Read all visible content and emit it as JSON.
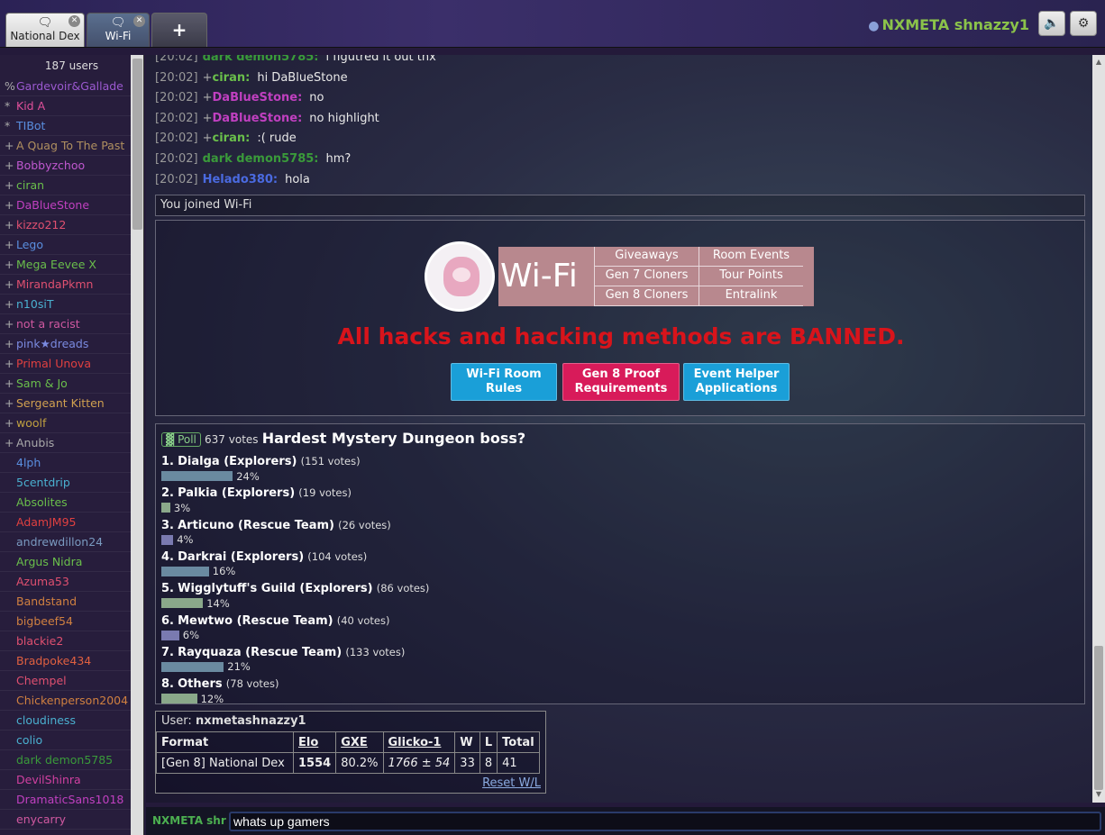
{
  "tabs": [
    {
      "label": "National Dex",
      "icon": "chat-bubble-icon"
    },
    {
      "label": "Wi-Fi",
      "icon": "chat-bubble-icon"
    }
  ],
  "add_tab": "+",
  "user": {
    "name": "NXMETA shnazzy1"
  },
  "userlist": {
    "count": "187 users",
    "users": [
      {
        "g": "%",
        "name": "Gardevoir&Gallade",
        "color": "#9b59d0"
      },
      {
        "g": "*",
        "name": "Kid A",
        "color": "#e0509a"
      },
      {
        "g": "*",
        "name": "TIBot",
        "color": "#5a8fe0"
      },
      {
        "g": "+",
        "name": "A Quag To The Past",
        "color": "#b09060"
      },
      {
        "g": "+",
        "name": "Bobbyzchoo",
        "color": "#c058d0"
      },
      {
        "g": "+",
        "name": "ciran",
        "color": "#6abf4b"
      },
      {
        "g": "+",
        "name": "DaBlueStone",
        "color": "#c040c0"
      },
      {
        "g": "+",
        "name": "kizzo212",
        "color": "#e05070"
      },
      {
        "g": "+",
        "name": "Lego",
        "color": "#5a8fe0"
      },
      {
        "g": "+",
        "name": "Mega Eevee X",
        "color": "#6abf4b"
      },
      {
        "g": "+",
        "name": "MirandaPkmn",
        "color": "#e05070"
      },
      {
        "g": "+",
        "name": "n10siT",
        "color": "#4ab0d0"
      },
      {
        "g": "+",
        "name": "not a racist",
        "color": "#d058a0"
      },
      {
        "g": "+",
        "name": "pink★dreads",
        "color": "#7a8ae0"
      },
      {
        "g": "+",
        "name": "Primal Unova",
        "color": "#e04040"
      },
      {
        "g": "+",
        "name": "Sam & Jo",
        "color": "#6abf4b"
      },
      {
        "g": "+",
        "name": "Sergeant Kitten",
        "color": "#d0a050"
      },
      {
        "g": "+",
        "name": "woolf",
        "color": "#c0a040"
      },
      {
        "g": "+",
        "name": "Anubis",
        "color": "#aaaaaa"
      },
      {
        "g": "",
        "name": "4lph",
        "color": "#5a8fe0"
      },
      {
        "g": "",
        "name": "5centdrip",
        "color": "#4ab0d0"
      },
      {
        "g": "",
        "name": "Absolites",
        "color": "#6abf4b"
      },
      {
        "g": "",
        "name": "AdamJM95",
        "color": "#e04040"
      },
      {
        "g": "",
        "name": "andrewdillon24",
        "color": "#7a9ac0"
      },
      {
        "g": "",
        "name": "Argus Nidra",
        "color": "#6abf4b"
      },
      {
        "g": "",
        "name": "Azuma53",
        "color": "#e05070"
      },
      {
        "g": "",
        "name": "Bandstand",
        "color": "#d08040"
      },
      {
        "g": "",
        "name": "bigbeef54",
        "color": "#d08040"
      },
      {
        "g": "",
        "name": "blackie2",
        "color": "#e05070"
      },
      {
        "g": "",
        "name": "Bradpoke434",
        "color": "#e06040"
      },
      {
        "g": "",
        "name": "Chempel",
        "color": "#e05070"
      },
      {
        "g": "",
        "name": "Chickenperson2004",
        "color": "#d08040"
      },
      {
        "g": "",
        "name": "cloudiness",
        "color": "#4ab0d0"
      },
      {
        "g": "",
        "name": "colio",
        "color": "#4ab0d0"
      },
      {
        "g": "",
        "name": "dark demon5785",
        "color": "#3a9a3a"
      },
      {
        "g": "",
        "name": "DevilShinra",
        "color": "#d040a0"
      },
      {
        "g": "",
        "name": "DramaticSans1018",
        "color": "#c040c0"
      },
      {
        "g": "",
        "name": "enycarry",
        "color": "#d058a0"
      }
    ]
  },
  "messages": [
    {
      "time": "[20:02]",
      "rank": "",
      "name": "dark demon5785:",
      "color": "#3a9a3a",
      "text": "i figutred it out thx"
    },
    {
      "time": "[20:02]",
      "rank": "+",
      "name": "ciran:",
      "color": "#6abf4b",
      "text": "hi DaBlueStone"
    },
    {
      "time": "[20:02]",
      "rank": "+",
      "name": "DaBlueStone:",
      "color": "#c040c0",
      "text": "no"
    },
    {
      "time": "[20:02]",
      "rank": "+",
      "name": "DaBlueStone:",
      "color": "#c040c0",
      "text": "no highlight"
    },
    {
      "time": "[20:02]",
      "rank": "+",
      "name": "ciran:",
      "color": "#6abf4b",
      "text": ":( rude"
    },
    {
      "time": "[20:02]",
      "rank": "",
      "name": "dark demon5785:",
      "color": "#3a9a3a",
      "text": "hm?"
    },
    {
      "time": "[20:02]",
      "rank": "",
      "name": "Helado380:",
      "color": "#4a6ae0",
      "text": "hola"
    }
  ],
  "joined": "You joined Wi-Fi",
  "banner": {
    "title": "Wi-Fi",
    "links": [
      "Giveaways",
      "Room Events",
      "Gen 7 Cloners",
      "Tour Points",
      "Gen 8 Cloners",
      "Entralink"
    ],
    "warning": "All hacks and hacking methods are BANNED.",
    "buttons": [
      {
        "label": "Wi-Fi Room Rules",
        "color": "#1a9fd8"
      },
      {
        "label": "Gen 8 Proof Requirements",
        "color": "#d81b5a"
      },
      {
        "label": "Event Helper Applications",
        "color": "#1a9fd8"
      }
    ]
  },
  "poll": {
    "badge": "Poll",
    "votes": "637 votes",
    "question": "Hardest Mystery Dungeon boss?",
    "options": [
      {
        "num": "1.",
        "label": "Dialga (Explorers)",
        "votes": "(151 votes)",
        "pct": "24%",
        "value": 24,
        "color": "#6a8aa0"
      },
      {
        "num": "2.",
        "label": "Palkia (Explorers)",
        "votes": "(19 votes)",
        "pct": "3%",
        "value": 3,
        "color": "#8aa88a"
      },
      {
        "num": "3.",
        "label": "Articuno (Rescue Team)",
        "votes": "(26 votes)",
        "pct": "4%",
        "value": 4,
        "color": "#7a7ab0"
      },
      {
        "num": "4.",
        "label": "Darkrai (Explorers)",
        "votes": "(104 votes)",
        "pct": "16%",
        "value": 16,
        "color": "#6a8aa0"
      },
      {
        "num": "5.",
        "label": "Wigglytuff's Guild (Explorers)",
        "votes": "(86 votes)",
        "pct": "14%",
        "value": 14,
        "color": "#8aa88a"
      },
      {
        "num": "6.",
        "label": "Mewtwo (Rescue Team)",
        "votes": "(40 votes)",
        "pct": "6%",
        "value": 6,
        "color": "#7a7ab0"
      },
      {
        "num": "7.",
        "label": "Rayquaza (Rescue Team)",
        "votes": "(133 votes)",
        "pct": "21%",
        "value": 21,
        "color": "#6a8aa0"
      },
      {
        "num": "8.",
        "label": "Others",
        "votes": "(78 votes)",
        "pct": "12%",
        "value": 12,
        "color": "#8aa88a"
      }
    ]
  },
  "ladder": {
    "user_label": "User:",
    "username": "nxmetashnazzy1",
    "headers": [
      "Format",
      "Elo",
      "GXE",
      "Glicko-1",
      "W",
      "L",
      "Total"
    ],
    "row": [
      "[Gen 8] National Dex",
      "1554",
      "80.2%",
      "1766 ± 54",
      "33",
      "8",
      "41"
    ],
    "reset": "Reset W/L"
  },
  "compose": {
    "name": "NXMETA shr",
    "value": "whats up gamers"
  }
}
